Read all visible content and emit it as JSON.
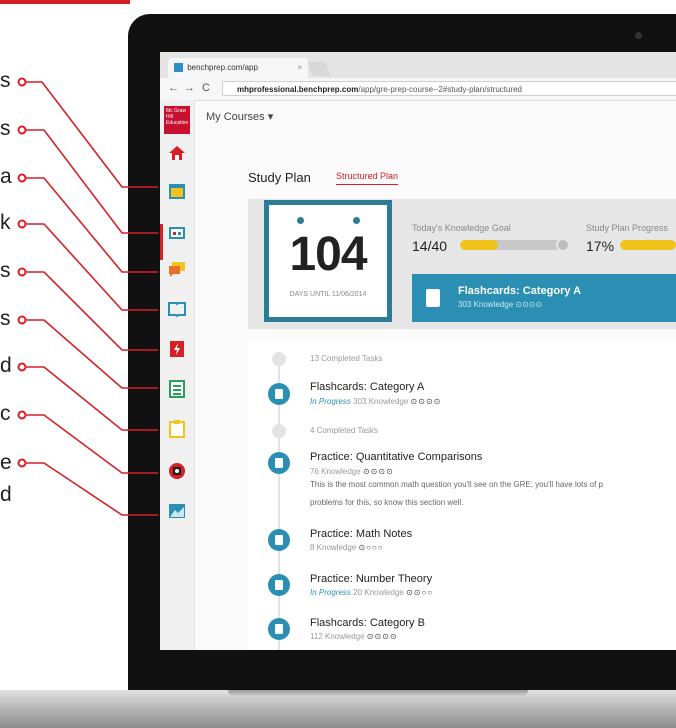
{
  "callouts": [
    "s",
    "s",
    "a",
    "k",
    "s",
    "s",
    "d",
    "c",
    "e",
    "d"
  ],
  "browser": {
    "tab_title": "benchprep.com/app",
    "tab_close": "×",
    "back": "←",
    "forward": "→",
    "reload": "C",
    "url_host": "mhprofessional.benchprep.com",
    "url_path": "/app/gre-prep-course--2#study-plan/structured"
  },
  "logo_text": "Mc Graw Hill Education",
  "nav": {
    "my_courses": "My Courses ▾"
  },
  "study_plan": {
    "title": "Study Plan",
    "tab": "Structured Plan",
    "countdown_number": "104",
    "countdown_caption": "DAYS UNTIL 11/06/2014",
    "knowledge_goal_label": "Today's Knowledge Goal",
    "knowledge_goal_value": "14/40",
    "knowledge_goal_fraction": 0.35,
    "progress_label": "Study Plan Progress",
    "progress_value": "17%",
    "progress_fraction": 0.17,
    "active_card": {
      "title": "Flashcards: Category A",
      "sub": "303 Knowledge ⊙⊙⊙⊙"
    }
  },
  "tasks": {
    "completed_1": "13 Completed Tasks",
    "completed_2": "4 Completed Tasks",
    "items": [
      {
        "title": "Flashcards: Category A",
        "status": "In Progress",
        "knowledge": "303 Knowledge",
        "dots": "⊙⊙⊙⊙"
      },
      {
        "title": "Practice: Quantitative Comparisons",
        "status": "",
        "knowledge": "76 Knowledge",
        "dots": "⊙⊙⊙⊙",
        "desc_1": "This is the most common math question you'll see on the GRE; you'll have lots of p",
        "desc_2": "problems for this, so know this section well."
      },
      {
        "title": "Practice: Math Notes",
        "status": "",
        "knowledge": "8 Knowledge",
        "dots": "⊙○○○"
      },
      {
        "title": "Practice: Number Theory",
        "status": "In Progress",
        "knowledge": "20 Knowledge",
        "dots": "⊙⊙○○"
      },
      {
        "title": "Flashcards: Category B",
        "status": "",
        "knowledge": "112 Knowledge",
        "dots": "⊙⊙⊙⊙"
      }
    ]
  },
  "colors": {
    "accent_red": "#d61f26",
    "teal": "#2c7c96",
    "blue": "#2a8fb3",
    "yellow": "#f2c31b"
  }
}
